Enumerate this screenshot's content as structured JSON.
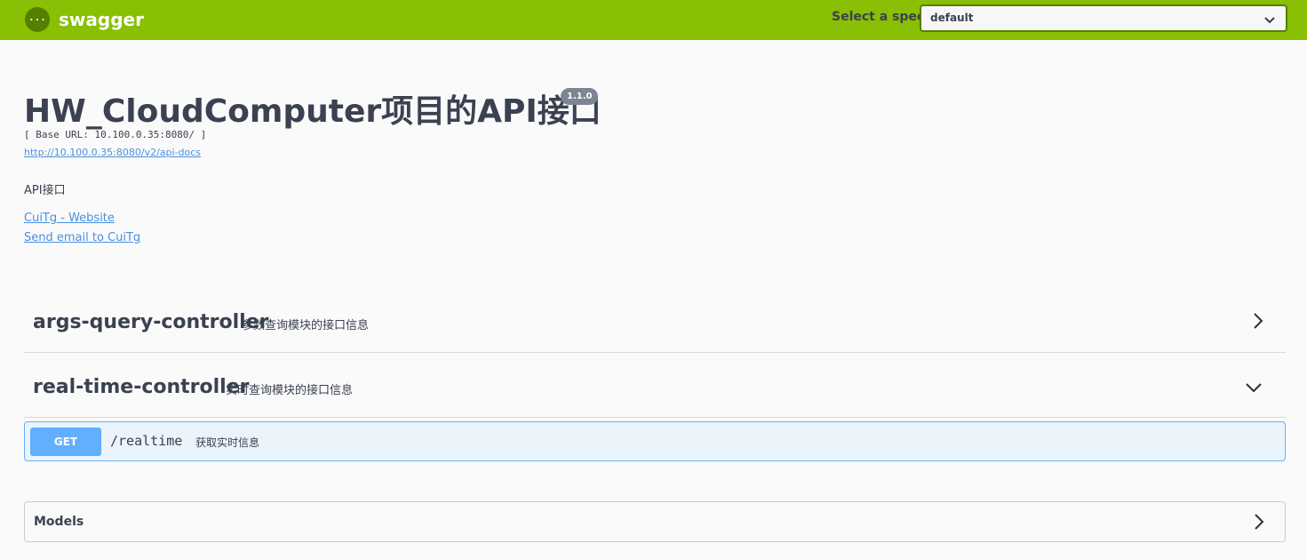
{
  "topbar": {
    "logo_text": "swagger",
    "spec_label": "Select a spec",
    "spec_selected": "default"
  },
  "info": {
    "title": "HW_CloudComputer项目的API接口",
    "version": "1.1.0",
    "base_url": "[ Base URL: 10.100.0.35:8080/ ]",
    "docs_url": "http://10.100.0.35:8080/v2/api-docs",
    "description": "API接口",
    "contact_website": "CuiTg - Website",
    "contact_email": "Send email to CuiTg"
  },
  "tags": [
    {
      "name": "args-query-controller",
      "description": "参数查询模块的接口信息",
      "expanded": false
    },
    {
      "name": "real-time-controller",
      "description": "实时查询模块的接口信息",
      "expanded": true
    }
  ],
  "operations": [
    {
      "method": "GET",
      "path": "/realtime",
      "summary": "获取实时信息"
    }
  ],
  "models": {
    "title": "Models"
  },
  "colors": {
    "topbar": "#89bf04",
    "get": "#61affe",
    "get_bg": "#ebf3fb",
    "link": "#4990e2",
    "text": "#3b4151"
  }
}
